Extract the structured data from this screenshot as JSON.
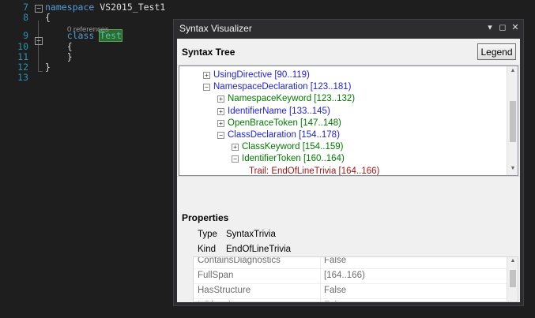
{
  "editor": {
    "lines": [
      {
        "num": "7",
        "tokens": [
          {
            "t": "namespace",
            "c": "kw"
          },
          {
            "t": " VS2015_Test1",
            "c": ""
          }
        ]
      },
      {
        "num": "8",
        "tokens": [
          {
            "t": "{",
            "c": ""
          }
        ]
      },
      {
        "num": "9",
        "tokens": [
          {
            "t": "    ",
            "c": ""
          },
          {
            "t": "class",
            "c": "kw"
          },
          {
            "t": " ",
            "c": ""
          },
          {
            "t": "Test",
            "c": "hl"
          }
        ]
      },
      {
        "num": "10",
        "tokens": [
          {
            "t": "    {",
            "c": ""
          }
        ]
      },
      {
        "num": "11",
        "tokens": [
          {
            "t": "    }",
            "c": ""
          }
        ]
      },
      {
        "num": "12",
        "tokens": [
          {
            "t": "}",
            "c": ""
          }
        ]
      },
      {
        "num": "13",
        "tokens": []
      }
    ],
    "references": "0 references"
  },
  "panel": {
    "title": "Syntax Visualizer",
    "buttons": {
      "dropdown": "▾",
      "maximize": "◻",
      "close": "✕"
    },
    "tree": {
      "title": "Syntax Tree",
      "legend_label": "Legend",
      "nodes": [
        {
          "label": "UsingDirective [90..119)",
          "color": "blue",
          "indent": 0,
          "expander": "+"
        },
        {
          "label": "NamespaceDeclaration [123..181)",
          "color": "blue",
          "indent": 0,
          "expander": "−"
        },
        {
          "label": "NamespaceKeyword [123..132)",
          "color": "green",
          "indent": 1,
          "expander": "+"
        },
        {
          "label": "IdentifierName [133..145)",
          "color": "blue",
          "indent": 1,
          "expander": "+"
        },
        {
          "label": "OpenBraceToken [147..148)",
          "color": "green",
          "indent": 1,
          "expander": "+"
        },
        {
          "label": "ClassDeclaration [154..178)",
          "color": "blue",
          "indent": 1,
          "expander": "−"
        },
        {
          "label": "ClassKeyword [154..159)",
          "color": "green",
          "indent": 2,
          "expander": "+"
        },
        {
          "label": "IdentifierToken [160..164)",
          "color": "green",
          "indent": 2,
          "expander": "−"
        },
        {
          "label": "Trail: EndOfLineTrivia [164..166)",
          "color": "red",
          "indent": 3,
          "expander": ""
        }
      ]
    },
    "properties": {
      "title": "Properties",
      "type_label": "Type",
      "type_value": "SyntaxTrivia",
      "kind_label": "Kind",
      "kind_value": "EndOfLineTrivia",
      "rows": [
        {
          "name": "ContainsDiagnostics",
          "value": "False"
        },
        {
          "name": "FullSpan",
          "value": "[164..166)"
        },
        {
          "name": "HasStructure",
          "value": "False"
        },
        {
          "name": "IsDirective",
          "value": "False"
        }
      ]
    }
  },
  "colors": {
    "editor_bg": "#1e1e1e",
    "keyword": "#569cd6",
    "type": "#4ec9b0",
    "line_number": "#2b91af",
    "node_blue": "#1f1fe0",
    "node_green": "#007a00",
    "node_red": "#a31515"
  }
}
